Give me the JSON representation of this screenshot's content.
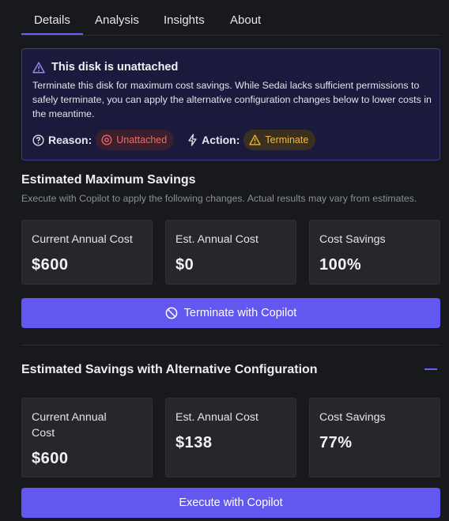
{
  "tabs": [
    {
      "label": "Details",
      "active": true
    },
    {
      "label": "Analysis",
      "active": false
    },
    {
      "label": "Insights",
      "active": false
    },
    {
      "label": "About",
      "active": false
    }
  ],
  "alert": {
    "title": "This disk is unattached",
    "body": "Terminate this disk for maximum cost savings. While Sedai lacks sufficient permissions to safely terminate, you can apply the alternative configuration changes below to lower costs in the meantime.",
    "reason_label": "Reason:",
    "reason_value": "Unattached",
    "action_label": "Action:",
    "action_value": "Terminate"
  },
  "max_savings": {
    "title": "Estimated Maximum Savings",
    "subtitle": "Execute with Copilot to apply the following changes. Actual results may vary from estimates.",
    "cards": [
      {
        "label": "Current Annual Cost",
        "value": "$600"
      },
      {
        "label": "Est. Annual Cost",
        "value": "$0"
      },
      {
        "label": "Cost Savings",
        "value": "100%"
      }
    ],
    "button": "Terminate with Copilot"
  },
  "alt_config": {
    "title": "Estimated Savings with Alternative Configuration",
    "cards": [
      {
        "label": "Current Annual Cost",
        "value": "$600"
      },
      {
        "label": "Est. Annual Cost",
        "value": "$138"
      },
      {
        "label": "Cost Savings",
        "value": "77%"
      }
    ],
    "button": "Execute with Copilot"
  },
  "colors": {
    "background": "#18191d",
    "accent": "#6257f0",
    "alert_bg": "#1b1a3d",
    "danger": "#f06a6a",
    "warning": "#f4b73e"
  }
}
